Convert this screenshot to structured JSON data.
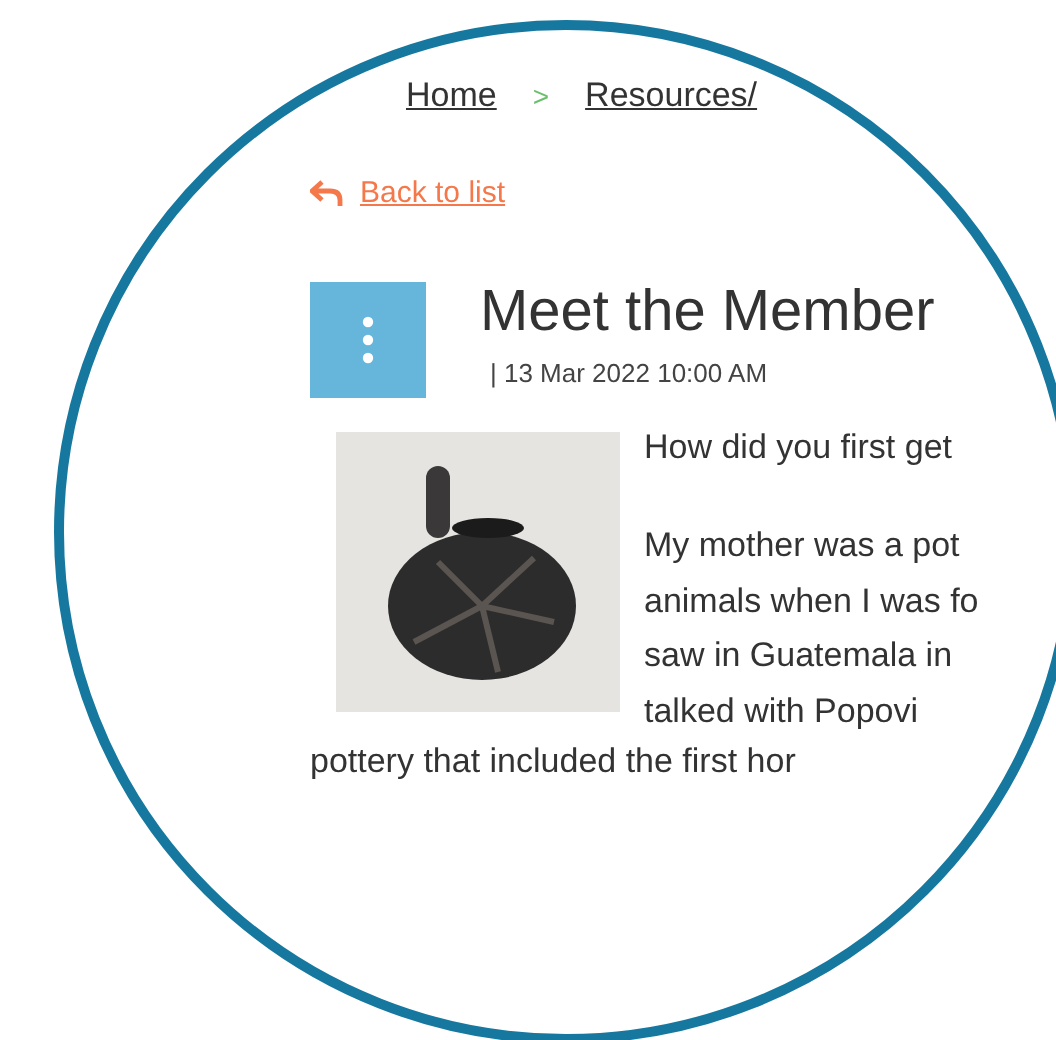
{
  "breadcrumb": {
    "items": [
      "Home",
      "Resources/"
    ],
    "separator": ">"
  },
  "back_link": {
    "label": "Back to list"
  },
  "article": {
    "title": "Meet the Member",
    "date": "| 13 Mar 2022 10:00 AM",
    "question": "How did you first get",
    "answer_lines": [
      "My mother was a pot",
      "animals when I was fo",
      "saw in Guatemala in",
      "talked with Popovi"
    ],
    "after_photo": "pottery that included the first hor"
  }
}
